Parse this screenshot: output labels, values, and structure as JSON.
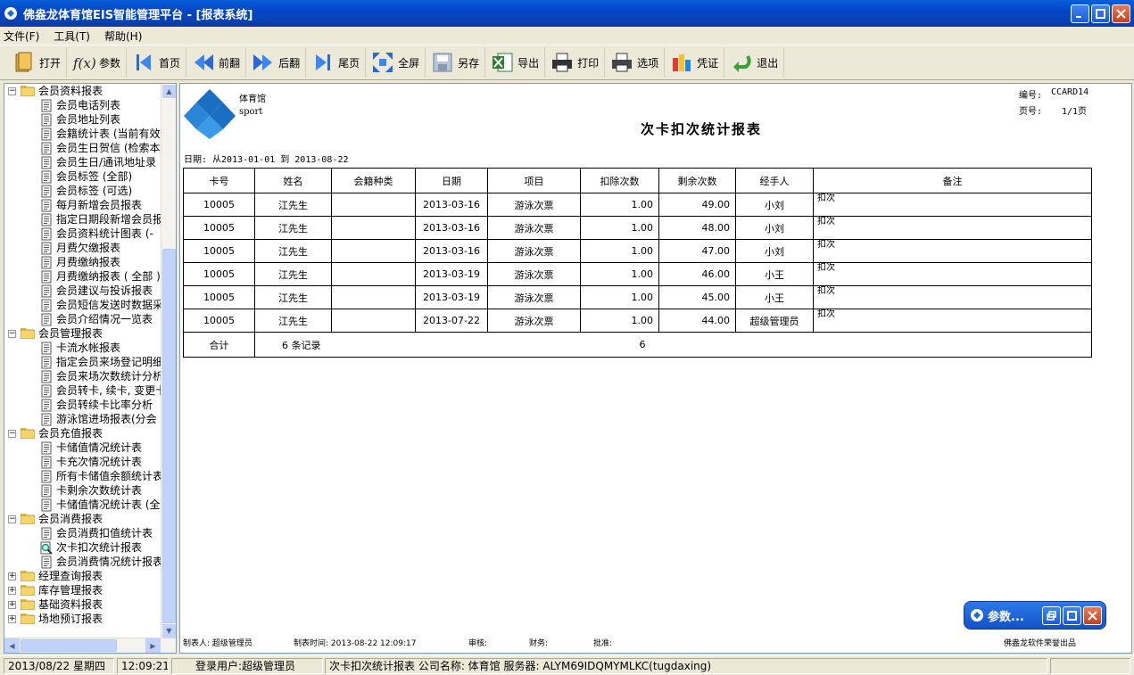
{
  "window": {
    "title": "佛盎龙体育馆EIS智能管理平台 - [报表系统]"
  },
  "menu": [
    {
      "label": "文件(F)"
    },
    {
      "label": "工具(T)"
    },
    {
      "label": "帮助(H)"
    }
  ],
  "toolbar": {
    "open": "打开",
    "params": "参数",
    "first": "首页",
    "prev": "前翻",
    "next": "后翻",
    "last": "尾页",
    "fullscreen": "全屏",
    "saveas": "另存",
    "export": "导出",
    "print": "打印",
    "options": "选项",
    "voucher": "凭证",
    "exit": "退出"
  },
  "tree": [
    {
      "level": 0,
      "type": "folder",
      "exp": "−",
      "label": "会员资料报表"
    },
    {
      "level": 1,
      "type": "doc",
      "label": "会员电话列表"
    },
    {
      "level": 1,
      "type": "doc",
      "label": "会员地址列表"
    },
    {
      "level": 1,
      "type": "doc",
      "label": "会籍统计表 (当前有效"
    },
    {
      "level": 1,
      "type": "doc",
      "label": "会员生日贺信 (检索本"
    },
    {
      "level": 1,
      "type": "doc",
      "label": "会员生日/通讯地址录"
    },
    {
      "level": 1,
      "type": "doc",
      "label": "会员标签 (全部)"
    },
    {
      "level": 1,
      "type": "doc",
      "label": "会员标签 (可选)"
    },
    {
      "level": 1,
      "type": "doc",
      "label": "每月新增会员报表"
    },
    {
      "level": 1,
      "type": "doc",
      "label": "指定日期段新增会员报"
    },
    {
      "level": 1,
      "type": "doc",
      "label": "会员资料统计图表 (-"
    },
    {
      "level": 1,
      "type": "doc",
      "label": "月费欠缴报表"
    },
    {
      "level": 1,
      "type": "doc",
      "label": "月费缴纳报表"
    },
    {
      "level": 1,
      "type": "doc",
      "label": "月费缴纳报表 ( 全部 )"
    },
    {
      "level": 1,
      "type": "doc",
      "label": "会员建议与投诉报表"
    },
    {
      "level": 1,
      "type": "doc",
      "label": "会员短信发送时数据采"
    },
    {
      "level": 1,
      "type": "doc",
      "label": "会员介绍情况一览表"
    },
    {
      "level": 0,
      "type": "folder",
      "exp": "−",
      "label": "会员管理报表"
    },
    {
      "level": 1,
      "type": "doc",
      "label": "卡流水帐报表"
    },
    {
      "level": 1,
      "type": "doc",
      "label": "指定会员来场登记明细"
    },
    {
      "level": 1,
      "type": "doc",
      "label": "会员来场次数统计分析"
    },
    {
      "level": 1,
      "type": "doc",
      "label": "会员转卡, 续卡, 变更卡"
    },
    {
      "level": 1,
      "type": "doc",
      "label": "会员转续卡比率分析"
    },
    {
      "level": 1,
      "type": "doc",
      "label": "游泳馆进场报表(分会"
    },
    {
      "level": 0,
      "type": "folder",
      "exp": "−",
      "label": "会员充值报表"
    },
    {
      "level": 1,
      "type": "doc",
      "label": "卡储值情况统计表"
    },
    {
      "level": 1,
      "type": "doc",
      "label": "卡充次情况统计表"
    },
    {
      "level": 1,
      "type": "doc",
      "label": "所有卡储值余额统计表"
    },
    {
      "level": 1,
      "type": "doc",
      "label": "卡剩余次数统计表"
    },
    {
      "level": 1,
      "type": "doc",
      "label": "卡储值情况统计表 (全"
    },
    {
      "level": 0,
      "type": "folder",
      "exp": "−",
      "label": "会员消费报表"
    },
    {
      "level": 1,
      "type": "doc",
      "label": "会员消费扣值统计表"
    },
    {
      "level": 1,
      "type": "active",
      "label": "次卡扣次统计报表"
    },
    {
      "level": 1,
      "type": "doc",
      "label": "会员消费情况统计报表"
    },
    {
      "level": 0,
      "type": "folder",
      "exp": "+",
      "label": "经理查询报表"
    },
    {
      "level": 0,
      "type": "folder",
      "exp": "+",
      "label": "库存管理报表"
    },
    {
      "level": 0,
      "type": "folder",
      "exp": "+",
      "label": "基础资料报表"
    },
    {
      "level": 0,
      "type": "folder",
      "exp": "+",
      "label": "场地预订报表"
    }
  ],
  "report": {
    "logo_text1": "体育馆",
    "logo_text2": "sport",
    "title": "次卡扣次统计报表",
    "code_label": "编号:",
    "code": "CCARD14",
    "page_label": "页号:",
    "page": "1/1页",
    "date_range": "日期: 从2013-01-01 到 2013-08-22",
    "columns": [
      "卡号",
      "姓名",
      "会籍种类",
      "日期",
      "项目",
      "扣除次数",
      "剩余次数",
      "经手人",
      "备注"
    ],
    "rows": [
      {
        "card": "10005",
        "name": "江先生",
        "type": "",
        "date": "2013-03-16",
        "item": "游泳次票",
        "deduct": "1.00",
        "remain": "49.00",
        "handler": "小刘",
        "note": "扣次"
      },
      {
        "card": "10005",
        "name": "江先生",
        "type": "",
        "date": "2013-03-16",
        "item": "游泳次票",
        "deduct": "1.00",
        "remain": "48.00",
        "handler": "小刘",
        "note": "扣次"
      },
      {
        "card": "10005",
        "name": "江先生",
        "type": "",
        "date": "2013-03-16",
        "item": "游泳次票",
        "deduct": "1.00",
        "remain": "47.00",
        "handler": "小刘",
        "note": "扣次"
      },
      {
        "card": "10005",
        "name": "江先生",
        "type": "",
        "date": "2013-03-19",
        "item": "游泳次票",
        "deduct": "1.00",
        "remain": "46.00",
        "handler": "小王",
        "note": "扣次"
      },
      {
        "card": "10005",
        "name": "江先生",
        "type": "",
        "date": "2013-03-19",
        "item": "游泳次票",
        "deduct": "1.00",
        "remain": "45.00",
        "handler": "小王",
        "note": "扣次"
      },
      {
        "card": "10005",
        "name": "江先生",
        "type": "",
        "date": "2013-07-22",
        "item": "游泳次票",
        "deduct": "1.00",
        "remain": "44.00",
        "handler": "超级管理员",
        "note": "扣次"
      }
    ],
    "total_label": "合计",
    "total_records": "6 条记录",
    "total_deduct": "6",
    "footer": {
      "maker": "制表人: 超级管理员",
      "time": "制表时间: 2013-08-22 12:09:17",
      "audit": "审核:",
      "finance": "财务:",
      "approve": "批准:",
      "vendor": "佛盎龙软件荣誉出品"
    }
  },
  "params_window": {
    "label": "参数..."
  },
  "status": {
    "date": "2013/08/22 星期四",
    "time": "12:09:21",
    "user": "登录用户:超级管理员",
    "info": "次卡扣次统计报表 公司名称: 体育馆 服务器: ALYM69IDQMYMLKC(tugdaxing)"
  },
  "colors": {
    "titlebar": "#0446c6",
    "window_bg": "#ece9d8",
    "logo_blue": "#1a6fc2"
  }
}
